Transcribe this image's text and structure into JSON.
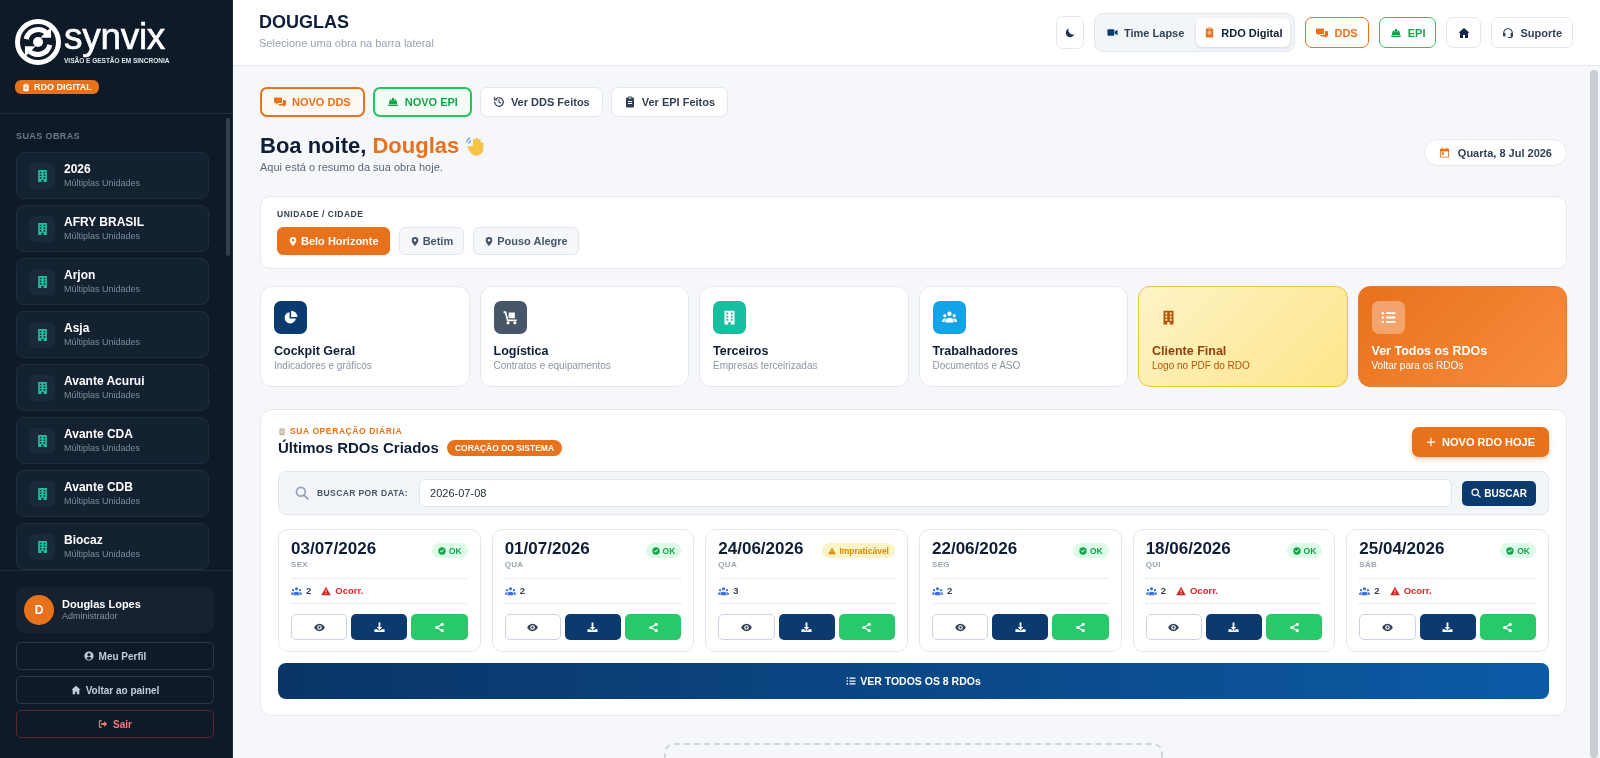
{
  "sidebar": {
    "logo": {
      "name": "synvix",
      "tagline": "VISÃO E GESTÃO EM SINCRONIA"
    },
    "badge": "RDO DIGITAL",
    "section_title": "SUAS OBRAS",
    "items": [
      {
        "name": "2026",
        "subtitle": "Múltiplas Unidades",
        "selected": false
      },
      {
        "name": "AFRY BRASIL",
        "subtitle": "Múltiplas Unidades",
        "selected": false
      },
      {
        "name": "Arjon",
        "subtitle": "Múltiplas Unidades",
        "selected": false
      },
      {
        "name": "Asja",
        "subtitle": "Múltiplas Unidades",
        "selected": false
      },
      {
        "name": "Avante Acurui",
        "subtitle": "Múltiplas Unidades",
        "selected": false
      },
      {
        "name": "Avante CDA",
        "subtitle": "Múltiplas Unidades",
        "selected": false
      },
      {
        "name": "Avante CDB",
        "subtitle": "Múltiplas Unidades",
        "selected": false
      },
      {
        "name": "Biocaz",
        "subtitle": "Múltiplas Unidades",
        "selected": false
      }
    ],
    "user": {
      "initial": "D",
      "name": "Douglas Lopes",
      "role": "Administrador"
    },
    "buttons": [
      {
        "kind": "profile",
        "label": "Meu Perfil"
      },
      {
        "kind": "home",
        "label": "Voltar ao painel"
      },
      {
        "kind": "logout",
        "label": "Sair"
      }
    ]
  },
  "header": {
    "title": "DOUGLAS",
    "subtitle": "Selecione uma obra na barra lateral",
    "mode_tabs": [
      {
        "kind": "timelapse",
        "label": "Time Lapse",
        "selected": false
      },
      {
        "kind": "rdo",
        "label": "RDO Digital",
        "selected": true
      }
    ],
    "buttons": [
      {
        "kind": "dds",
        "label": "DDS"
      },
      {
        "kind": "epi",
        "label": "EPI"
      },
      {
        "kind": "home"
      },
      {
        "kind": "support",
        "label": "Suporte"
      }
    ]
  },
  "actions": [
    {
      "kind": "dds",
      "label": "NOVO DDS"
    },
    {
      "kind": "epi",
      "label": "NOVO EPI"
    },
    {
      "kind": "history",
      "label": "Ver DDS Feitos"
    },
    {
      "kind": "clipboard",
      "label": "Ver EPI Feitos"
    }
  ],
  "greeting": {
    "text": "Boa noite,",
    "name": "Douglas",
    "subtitle": "Aqui está o resumo da sua obra hoje.",
    "date": "Quarta, 8 Jul 2026"
  },
  "units": {
    "label": "UNIDADE / CIDADE",
    "chips": [
      {
        "label": "Belo Horizonte",
        "selected": true
      },
      {
        "label": "Betim",
        "selected": false
      },
      {
        "label": "Pouso Alegre",
        "selected": false
      }
    ]
  },
  "shortcuts": [
    {
      "kind": "cockpit",
      "title": "Cockpit Geral",
      "subtitle": "Indicadores e gráficos"
    },
    {
      "kind": "logistics",
      "title": "Logística",
      "subtitle": "Contratos e equipamentos"
    },
    {
      "kind": "contractors",
      "title": "Terceiros",
      "subtitle": "Empresas terceirizadas"
    },
    {
      "kind": "workers",
      "title": "Trabalhadores",
      "subtitle": "Documentos e ASO"
    },
    {
      "kind": "client",
      "title": "Cliente Final",
      "subtitle": "Logo no PDF do RDO"
    },
    {
      "kind": "rdos",
      "title": "Ver Todos os RDOs",
      "subtitle": "Voltar para os RDOs"
    }
  ],
  "rdo_section": {
    "eyebrow": "SUA OPERAÇÃO DIÁRIA",
    "title": "Últimos RDOs Criados",
    "tag": "CORAÇÃO DO SISTEMA",
    "new_button": "NOVO RDO HOJE",
    "search": {
      "label": "BUSCAR POR DATA:",
      "value": "2026-07-08",
      "button": "BUSCAR"
    },
    "cards": [
      {
        "date": "03/07/2026",
        "weekday": "SEX",
        "status": {
          "kind": "ok",
          "label": "OK"
        },
        "workers": "2",
        "occurrence": "Ocorr."
      },
      {
        "date": "01/07/2026",
        "weekday": "QUA",
        "status": {
          "kind": "ok",
          "label": "OK"
        },
        "workers": "2"
      },
      {
        "date": "24/06/2026",
        "weekday": "QUA",
        "status": {
          "kind": "warning",
          "label": "Impraticável"
        },
        "workers": "3"
      },
      {
        "date": "22/06/2026",
        "weekday": "SEG",
        "status": {
          "kind": "ok",
          "label": "OK"
        },
        "workers": "2"
      },
      {
        "date": "18/06/2026",
        "weekday": "QUI",
        "status": {
          "kind": "ok",
          "label": "OK"
        },
        "workers": "2",
        "occurrence": "Ocorr."
      },
      {
        "date": "25/04/2026",
        "weekday": "SÁB",
        "status": {
          "kind": "ok",
          "label": "OK"
        },
        "workers": "2",
        "occurrence": "Ocorr."
      }
    ],
    "view_all": "VER TODOS OS 8 RDOs"
  }
}
